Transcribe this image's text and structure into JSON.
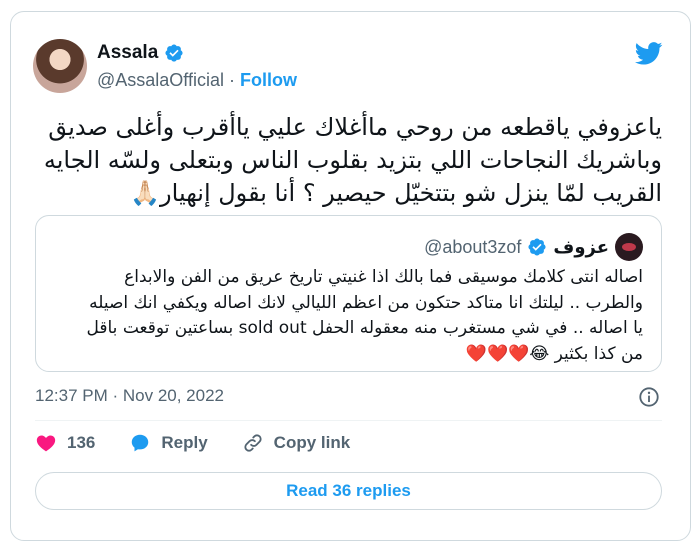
{
  "author": {
    "name": "Assala",
    "handle": "@AssalaOfficial",
    "separator": "·",
    "follow_label": "Follow"
  },
  "tweet": {
    "lines": [
      "ياعزوفي ياقطعه من روحي ماأغلاك  عليي ياأقرب وأغلى صديق",
      "وباشريك النجاحات اللي بتزيد بقلوب الناس وبتعلى ولسّه الجايه",
      "القريب لمّا ينزل شو بتتخيّل حيصير ؟ أنا بقول إنهيار🙏🏻"
    ]
  },
  "quoted_tweet": {
    "name": "عزوف",
    "handle": "@about3zof",
    "lines": [
      "اصاله انتى كلامك موسيقى فما بالك اذا غنيتي تاريخ عريق من الفن والابداع",
      "والطرب .. ليلتك انا متاكد حتكون من اعظم الليالي لانك اصاله ويكفي انك اصيله",
      "يا اصاله .. في شي مستغرب منه معقوله الحفل sold out بساعتين توقعت باقل",
      "من كذا بكثير 😂❤️❤️❤️"
    ]
  },
  "timestamp": "12:37 PM · Nov 20, 2022",
  "actions": {
    "like_count": "136",
    "reply_label": "Reply",
    "copy_link_label": "Copy link"
  },
  "read_replies_label": "Read 36 replies",
  "colors": {
    "accent": "#1d9bf0",
    "heart": "#f91880",
    "text": "#0f1419",
    "muted": "#536471"
  }
}
